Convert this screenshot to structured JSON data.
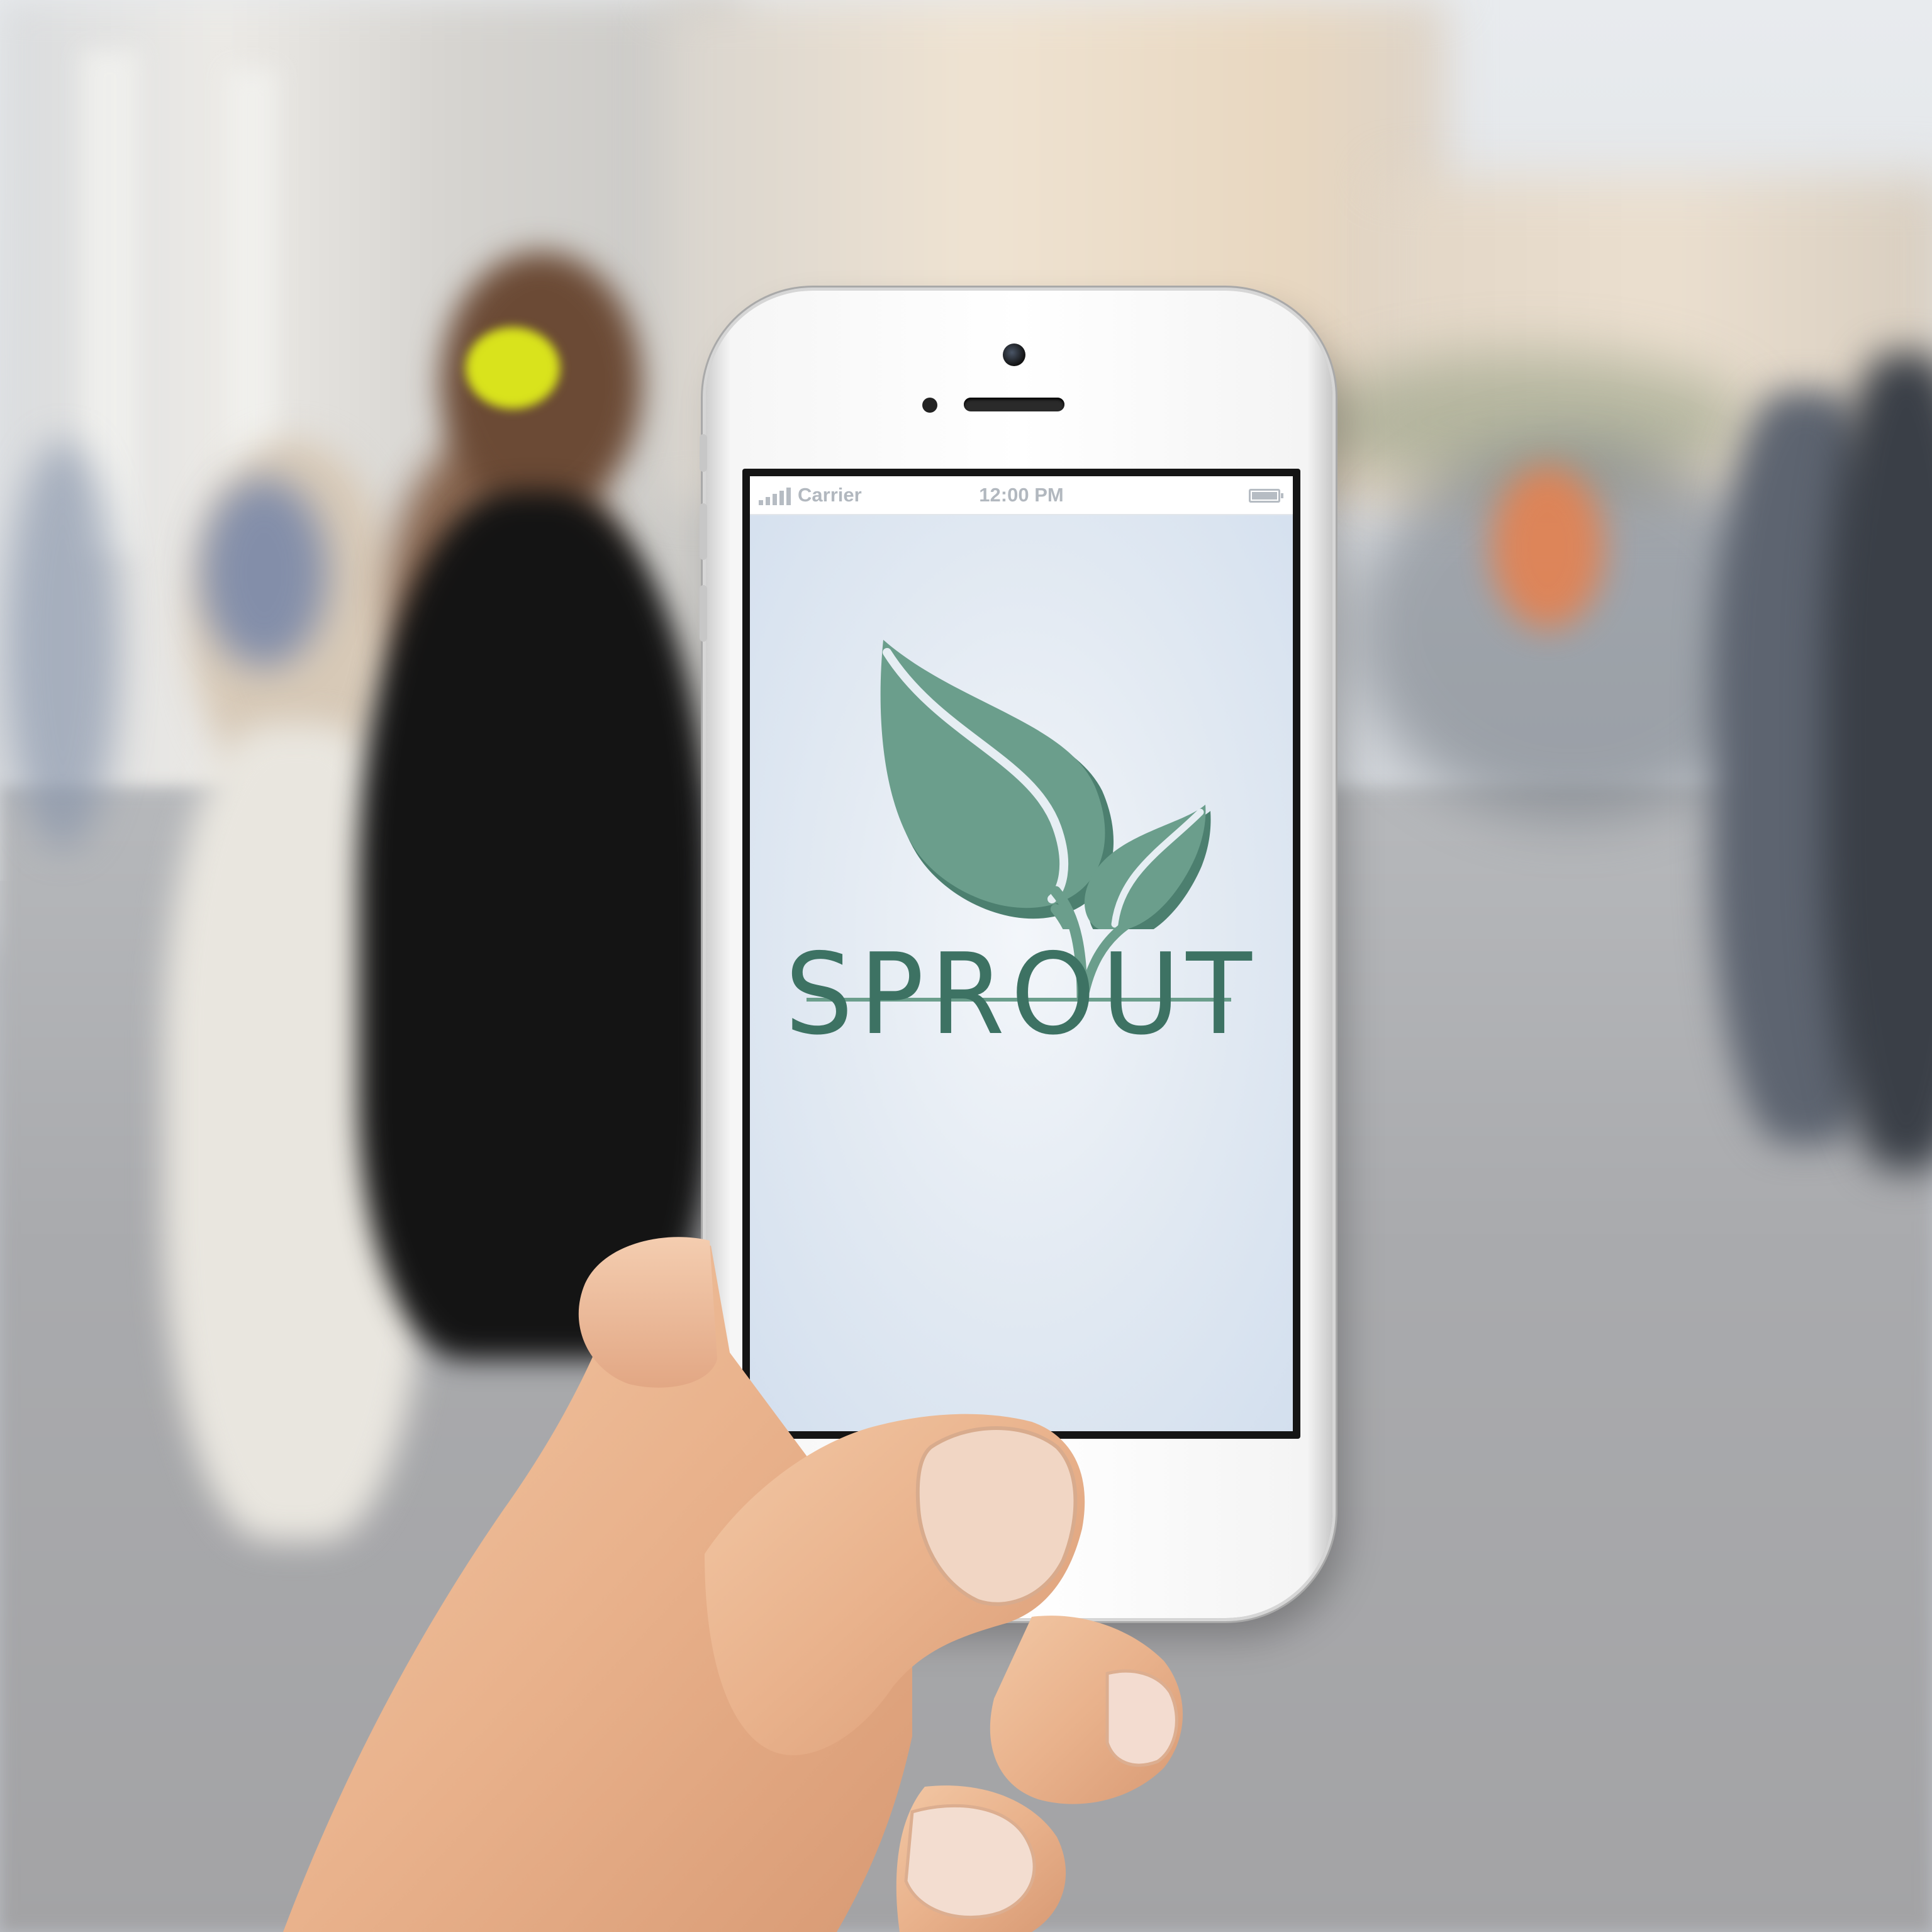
{
  "status_bar": {
    "carrier": "Carrier",
    "time": "12:00 PM"
  },
  "app": {
    "name": "SPROUT",
    "logo_icon": "sprout-leaves-icon",
    "accent_color": "#6b9e8c",
    "text_color": "#3d7263"
  }
}
